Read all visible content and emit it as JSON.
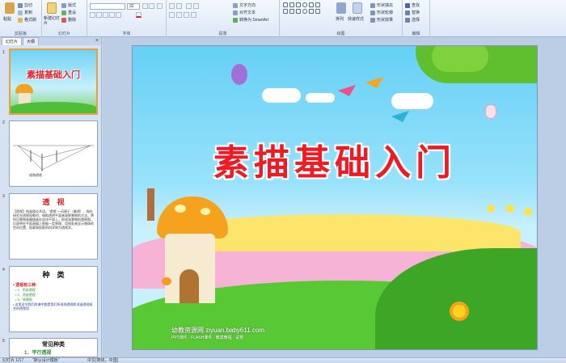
{
  "ribbon": {
    "clipboard": {
      "paste": "粘贴",
      "cut": "剪切",
      "copy": "复制",
      "format_painter": "格式刷",
      "label": "剪贴板"
    },
    "slides": {
      "new_slide": "新建幻灯片",
      "layout": "版式",
      "reset": "重设",
      "delete": "删除",
      "label": "幻灯片"
    },
    "font": {
      "font_name": "",
      "font_size": "32",
      "label": "字体"
    },
    "paragraph": {
      "text_direction": "文字方向",
      "align_text": "对齐文本",
      "smartart": "转换为 SmartArt",
      "label": "段落"
    },
    "drawing": {
      "arrange": "排列",
      "quick_styles": "快速样式",
      "shape_fill": "形状填充",
      "shape_outline": "形状轮廓",
      "shape_effects": "形状效果",
      "label": "绘图"
    },
    "editing": {
      "find": "查找",
      "replace": "替换",
      "select": "选择",
      "label": "编辑"
    }
  },
  "panel": {
    "tabs": [
      "幻灯片",
      "大纲"
    ],
    "close": "×",
    "slide_numbers": [
      "1",
      "2",
      "3",
      "4",
      "5"
    ],
    "thumb1_title": "素描基础入门",
    "thumb2_caption": "成角透视",
    "thumb3_title": "透　视",
    "thumb3_body": "【透视】绘画理论术语。\"透视\"一词源于（着透），指在研究光透视现象时，借助透明平面来观察景物的方法。将所见景物准确描画在这块平面上，即成该景物的透视图。后遂将在平面画幅上根据一定原理，用线条来显示物体的空间位置、轮廓和投影的科学称为透视学。",
    "thumb4_title": "种　类",
    "thumb4_lines": [
      "• 透视有三种:",
      "• 1．色彩透视",
      "• 2．消逝透视",
      "• 3．线透视",
      "• 这里这节我们的课中都是我们所说线透视和消逝透视结合的透视用"
    ],
    "thumb5_title": "常见种类",
    "thumb5_line": "1．平行透视"
  },
  "slide": {
    "title": "素描基础入门",
    "watermark": "幼教资源网 ziyuan.baby611.com",
    "watermark_sub": "PPT课件 · FLASH课件 · 教案教程 · 试卷"
  },
  "status": {
    "slide_info": "幻灯片 1/17",
    "theme": "\"默认设计模板\"",
    "language": "中文(简体，中国)"
  },
  "colors": {
    "title_red": "#ee1b24",
    "sky": "#66d0f5",
    "selection": "#e8a13a"
  }
}
